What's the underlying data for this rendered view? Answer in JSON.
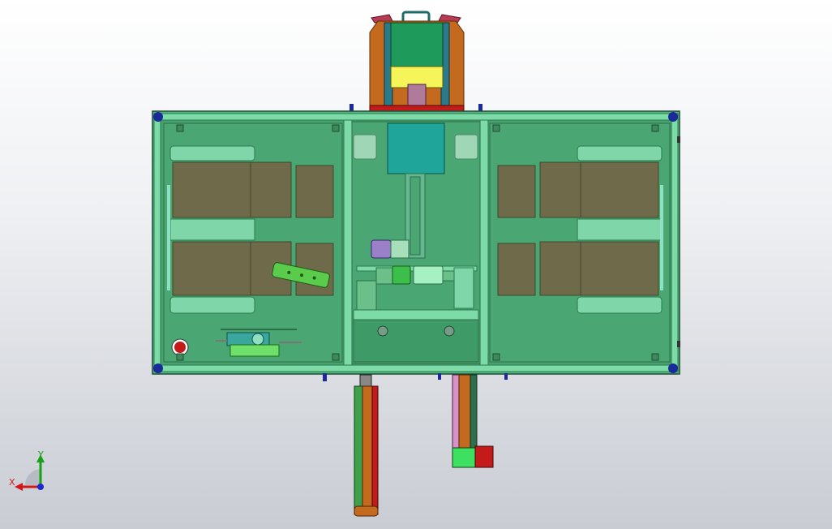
{
  "viewport": {
    "background_top": "#ffffff",
    "background_bottom": "#c9ccd3"
  },
  "colors": {
    "frame": "#5cc98f",
    "frame_edge": "#1f6e44",
    "plate": "#47a36e",
    "pallet": "#6e6a4a",
    "pallet_edge": "#3d4a2c",
    "teal": "#1fa59a",
    "orange": "#c46a1e",
    "red": "#c41a1a",
    "yellow": "#f5f55a",
    "dark_green": "#1e8a4a",
    "purple": "#9c7fc9",
    "pink": "#d790c8",
    "blue": "#1a2a9a"
  },
  "axis_triad": {
    "x_label": "X",
    "y_label": "Y",
    "x_color": "#d01818",
    "y_color": "#18a018",
    "origin_color": "#1a2ad0"
  }
}
